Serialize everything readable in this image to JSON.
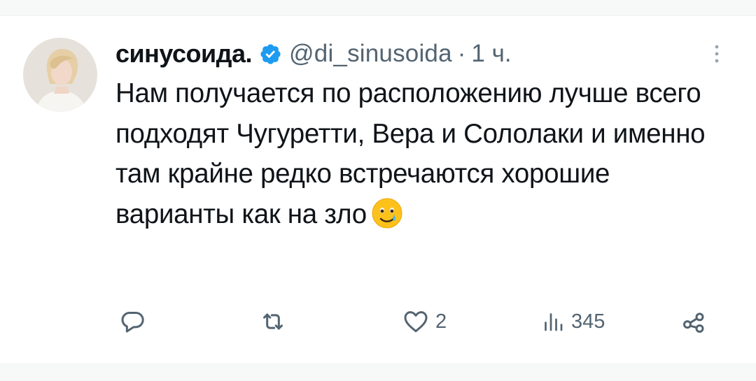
{
  "tweet": {
    "author": {
      "display_name": "синусоида.",
      "handle": "@di_sinusoida",
      "verified": true,
      "avatar_icon": "user-avatar"
    },
    "timestamp_separator": "·",
    "timestamp": "1 ч.",
    "text": "Нам получается по расположению лучше всего подходят Чугуретти, Вера и Сололаки и именно там крайне редко встречаются хорошие варианты как на зло",
    "emoji": "face-holding-back-tears-icon",
    "actions": {
      "reply_icon": "reply-icon",
      "retweet_icon": "retweet-icon",
      "like_icon": "heart-icon",
      "like_count": "2",
      "views_icon": "views-icon",
      "views_count": "345",
      "share_icon": "share-icon"
    }
  },
  "colors": {
    "text_primary": "#0f1419",
    "text_secondary": "#536471",
    "verified_blue": "#1d9bf0",
    "background": "#ffffff"
  }
}
